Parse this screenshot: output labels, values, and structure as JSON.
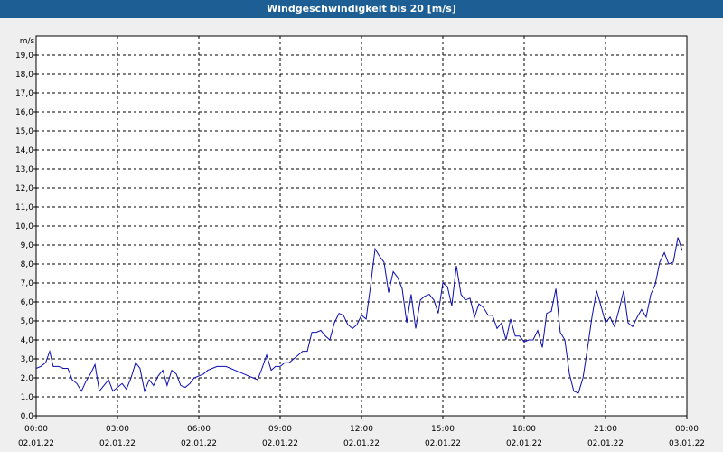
{
  "window": {
    "title": "Windgeschwindigkeit bis 20 [m/s]"
  },
  "chart_data": {
    "type": "line",
    "title": "Windgeschwindigkeit bis 20 [m/s]",
    "ylabel": "m/s",
    "xlabel": "",
    "ylim": [
      0,
      20
    ],
    "xlim_hours": [
      0,
      24
    ],
    "grid": true,
    "colors": {
      "series": "#0b0bb0",
      "grid": "#000000",
      "plot_bg": "#ffffff"
    },
    "y_ticks": [
      "0,0",
      "1,0",
      "2,0",
      "3,0",
      "4,0",
      "5,0",
      "6,0",
      "7,0",
      "8,0",
      "9,0",
      "10,0",
      "11,0",
      "12,0",
      "13,0",
      "14,0",
      "15,0",
      "16,0",
      "17,0",
      "18,0",
      "19,0"
    ],
    "x_ticks": [
      {
        "time": "00:00",
        "date": "02.01.22"
      },
      {
        "time": "03:00",
        "date": "02.01.22"
      },
      {
        "time": "06:00",
        "date": "02.01.22"
      },
      {
        "time": "09:00",
        "date": "02.01.22"
      },
      {
        "time": "12:00",
        "date": "02.01.22"
      },
      {
        "time": "15:00",
        "date": "02.01.22"
      },
      {
        "time": "18:00",
        "date": "02.01.22"
      },
      {
        "time": "21:00",
        "date": "02.01.22"
      },
      {
        "time": "00:00",
        "date": "03.01.22"
      }
    ],
    "series": [
      {
        "x": [
          0.0,
          0.17,
          0.35,
          0.5,
          0.63,
          0.83,
          1.0,
          1.17,
          1.33,
          1.5,
          1.67,
          1.83,
          2.0,
          2.17,
          2.33,
          2.5,
          2.67,
          2.83,
          3.0,
          3.17,
          3.33,
          3.5,
          3.67,
          3.83,
          4.0,
          4.17,
          4.33,
          4.5,
          4.67,
          4.83,
          5.0,
          5.17,
          5.33,
          5.5,
          5.67,
          5.83,
          6.0,
          6.17,
          6.33,
          6.5,
          6.67,
          6.83,
          7.0,
          7.17,
          7.33,
          7.5,
          7.67,
          7.83,
          8.0,
          8.17,
          8.33,
          8.5,
          8.67,
          8.83,
          9.0,
          9.17,
          9.33,
          9.5,
          9.67,
          9.83,
          10.0,
          10.17,
          10.33,
          10.5,
          10.67,
          10.83,
          11.0,
          11.17,
          11.33,
          11.5,
          11.67,
          11.83,
          12.0,
          12.17,
          12.33,
          12.5,
          12.67,
          12.83,
          13.0,
          13.17,
          13.33,
          13.5,
          13.67,
          13.83,
          14.0,
          14.17,
          14.33,
          14.5,
          14.67,
          14.83,
          15.0,
          15.17,
          15.33,
          15.5,
          15.67,
          15.83,
          16.0,
          16.17,
          16.33,
          16.5,
          16.67,
          16.83,
          17.0,
          17.17,
          17.33,
          17.5,
          17.67,
          17.83,
          18.0,
          18.17,
          18.33,
          18.5,
          18.67,
          18.83,
          19.0,
          19.17,
          19.33,
          19.5,
          19.67,
          19.83,
          20.0,
          20.17,
          20.33,
          20.5,
          20.67,
          20.83,
          21.0,
          21.17,
          21.33,
          21.5,
          21.67,
          21.83,
          22.0,
          22.17,
          22.33,
          22.5,
          22.67,
          22.83,
          23.0,
          23.17,
          23.33,
          23.5,
          23.67,
          23.83
        ],
        "y": [
          2.5,
          2.6,
          2.8,
          3.4,
          2.6,
          2.6,
          2.5,
          2.5,
          1.9,
          1.7,
          1.3,
          1.8,
          2.2,
          2.7,
          1.3,
          1.6,
          1.9,
          1.3,
          1.5,
          1.7,
          1.4,
          2.0,
          2.8,
          2.5,
          1.3,
          1.9,
          1.6,
          2.1,
          2.4,
          1.6,
          2.4,
          2.2,
          1.6,
          1.5,
          1.7,
          2.0,
          2.1,
          2.2,
          2.4,
          2.5,
          2.6,
          2.6,
          2.6,
          2.5,
          2.4,
          2.3,
          2.2,
          2.1,
          2.0,
          1.9,
          2.5,
          3.2,
          2.4,
          2.6,
          2.6,
          2.8,
          2.8,
          3.0,
          3.2,
          3.4,
          3.4,
          4.4,
          4.4,
          4.5,
          4.2,
          4.0,
          4.9,
          5.4,
          5.3,
          4.8,
          4.6,
          4.8,
          5.3,
          5.1,
          6.8,
          8.8,
          8.4,
          8.1,
          6.5,
          7.6,
          7.3,
          6.7,
          4.9,
          6.4,
          4.6,
          6.1,
          6.3,
          6.4,
          6.1,
          5.4,
          7.0,
          6.8,
          5.8,
          7.9,
          6.4,
          6.1,
          6.2,
          5.2,
          5.9,
          5.7,
          5.3,
          5.3,
          4.6,
          4.9,
          4.0,
          5.1,
          4.2,
          4.2,
          3.9,
          4.0,
          4.0,
          4.5,
          3.6,
          5.4,
          5.5,
          6.7,
          4.4,
          4.0,
          2.2,
          1.3,
          1.2,
          2.0,
          3.5,
          5.2,
          6.6,
          5.8,
          4.9,
          5.2,
          4.7,
          5.6,
          6.6,
          4.9,
          4.7,
          5.2,
          5.6,
          5.2,
          6.4,
          6.9,
          8.1,
          8.6,
          8.0,
          8.1,
          9.4,
          8.7
        ]
      }
    ]
  }
}
